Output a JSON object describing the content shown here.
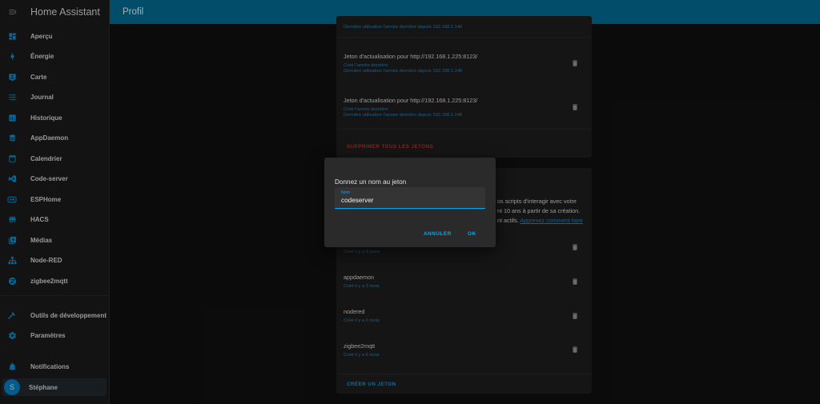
{
  "app": {
    "title": "Home Assistant"
  },
  "header": {
    "title": "Profil"
  },
  "sidebar": {
    "items": [
      {
        "label": "Aperçu",
        "icon": "view-dashboard-icon"
      },
      {
        "label": "Énergie",
        "icon": "lightning-bolt-icon"
      },
      {
        "label": "Carte",
        "icon": "map-account-icon"
      },
      {
        "label": "Journal",
        "icon": "format-list-bulleted-icon"
      },
      {
        "label": "Historique",
        "icon": "chart-box-icon"
      },
      {
        "label": "AppDaemon",
        "icon": "database-icon"
      },
      {
        "label": "Calendrier",
        "icon": "calendar-icon"
      },
      {
        "label": "Code-server",
        "icon": "visual-studio-code-icon"
      },
      {
        "label": "ESPHome",
        "icon": "esphome-icon"
      },
      {
        "label": "HACS",
        "icon": "store-icon"
      },
      {
        "label": "Médias",
        "icon": "play-box-multiple-icon"
      },
      {
        "label": "Node-RED",
        "icon": "sitemap-icon"
      },
      {
        "label": "zigbee2mqtt",
        "icon": "zigbee-icon"
      }
    ],
    "tools": [
      {
        "label": "Outils de développement",
        "icon": "hammer-icon"
      },
      {
        "label": "Paramètres",
        "icon": "cog-icon"
      }
    ],
    "notifications": {
      "label": "Notifications",
      "icon": "bell-icon"
    },
    "user": {
      "label": "Stéphane",
      "initial": "S"
    }
  },
  "refresh_tokens": {
    "top_partial_sub": "Dernière utilisation l'année dernière depuis 192.168.1.146",
    "items": [
      {
        "title": "Jeton d'actualisation pour http://192.168.1.225:8123/",
        "created": "Créé l'année dernière",
        "last_used": "Dernière utilisation l'année dernière depuis 192.168.1.146"
      },
      {
        "title": "Jeton d'actualisation pour http://192.168.1.225:8123/",
        "created": "Créé l'année dernière",
        "last_used": "Dernière utilisation l'année dernière depuis 192.168.1.146"
      }
    ],
    "delete_all_label": "SUPPRIMER TOUS LES JETONS"
  },
  "long_lived_tokens": {
    "desc_line1": "os scripts d'interagir avec votre",
    "desc_line2": "nt 10 ans à partir de sa création.",
    "desc_line3": "nt actifs.",
    "learn_more": "Apprenez comment faire",
    "items": [
      {
        "name": "",
        "created": "Créé il y a 3 jours"
      },
      {
        "name": "appdaemon",
        "created": "Créé il y a 3 mois"
      },
      {
        "name": "nodered",
        "created": "Créé il y a 6 mois"
      },
      {
        "name": "zigbee2mqtt",
        "created": "Créé il y a 6 mois"
      }
    ],
    "create_label": "CRÉER UN JETON"
  },
  "dialog": {
    "title": "Donnez un nom au jeton",
    "field_label": "Nom",
    "field_value": "codeserver",
    "cancel_label": "ANNULER",
    "ok_label": "OK"
  },
  "colors": {
    "header": "#03729b",
    "accent": "#03a9f4",
    "link": "#2a8bc6",
    "danger": "#b83a3a",
    "sidebar_icon": "#039be5"
  }
}
